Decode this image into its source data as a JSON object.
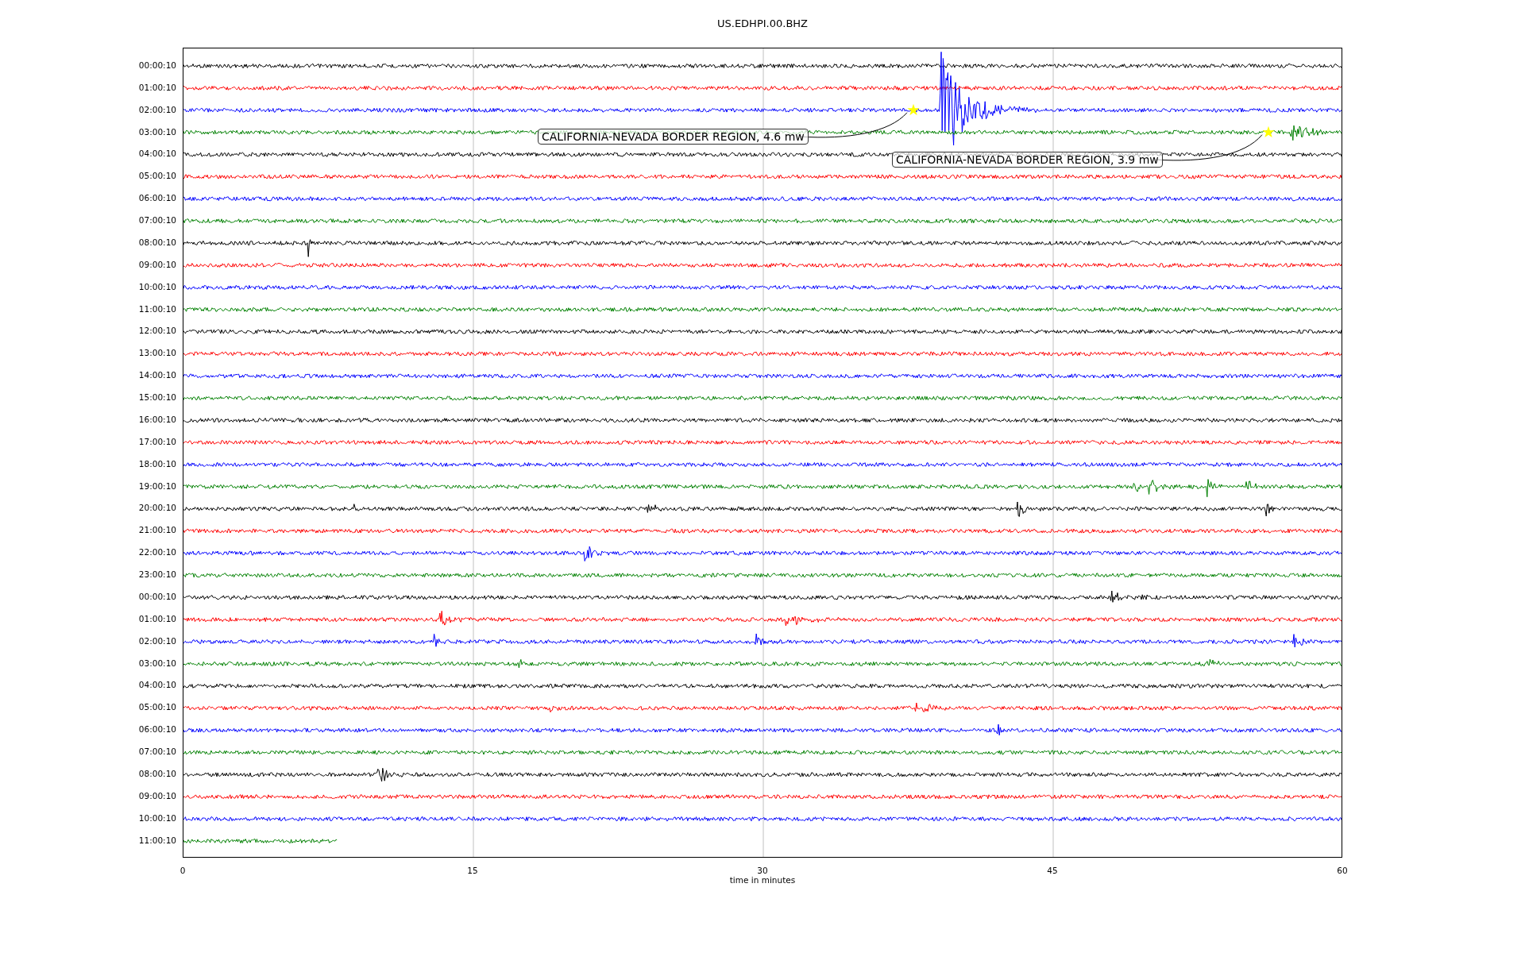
{
  "figure": {
    "title": "US.EDHPI.00.BHZ",
    "rows": [
      {
        "label": "00:00:10",
        "color": "#000000",
        "level": 1
      },
      {
        "label": "01:00:10",
        "color": "#ff0000",
        "level": 1
      },
      {
        "label": "02:00:10",
        "color": "#0000ff",
        "level": 1
      },
      {
        "label": "03:00:10",
        "color": "#008000",
        "level": 1
      },
      {
        "label": "04:00:10",
        "color": "#000000",
        "level": 1
      },
      {
        "label": "05:00:10",
        "color": "#ff0000",
        "level": 1
      },
      {
        "label": "06:00:10",
        "color": "#0000ff",
        "level": 1
      },
      {
        "label": "07:00:10",
        "color": "#008000",
        "level": 1
      },
      {
        "label": "08:00:10",
        "color": "#000000",
        "level": 1
      },
      {
        "label": "09:00:10",
        "color": "#ff0000",
        "level": 1
      },
      {
        "label": "10:00:10",
        "color": "#0000ff",
        "level": 1
      },
      {
        "label": "11:00:10",
        "color": "#008000",
        "level": 1
      },
      {
        "label": "12:00:10",
        "color": "#000000",
        "level": 1
      },
      {
        "label": "13:00:10",
        "color": "#ff0000",
        "level": 1
      },
      {
        "label": "14:00:10",
        "color": "#0000ff",
        "level": 1
      },
      {
        "label": "15:00:10",
        "color": "#008000",
        "level": 1
      },
      {
        "label": "16:00:10",
        "color": "#000000",
        "level": 1
      },
      {
        "label": "17:00:10",
        "color": "#ff0000",
        "level": 1
      },
      {
        "label": "18:00:10",
        "color": "#0000ff",
        "level": 1
      },
      {
        "label": "19:00:10",
        "color": "#008000",
        "level": 1
      },
      {
        "label": "20:00:10",
        "color": "#000000",
        "level": 1
      },
      {
        "label": "21:00:10",
        "color": "#ff0000",
        "level": 1
      },
      {
        "label": "22:00:10",
        "color": "#0000ff",
        "level": 1
      },
      {
        "label": "23:00:10",
        "color": "#008000",
        "level": 1
      },
      {
        "label": "00:00:10",
        "color": "#000000",
        "level": 1
      },
      {
        "label": "01:00:10",
        "color": "#ff0000",
        "level": 1
      },
      {
        "label": "02:00:10",
        "color": "#0000ff",
        "level": 1
      },
      {
        "label": "03:00:10",
        "color": "#008000",
        "level": 1
      },
      {
        "label": "04:00:10",
        "color": "#000000",
        "level": 1
      },
      {
        "label": "05:00:10",
        "color": "#ff0000",
        "level": 1
      },
      {
        "label": "06:00:10",
        "color": "#0000ff",
        "level": 1
      },
      {
        "label": "07:00:10",
        "color": "#008000",
        "level": 1
      },
      {
        "label": "08:00:10",
        "color": "#000000",
        "level": 1
      },
      {
        "label": "09:00:10",
        "color": "#ff0000",
        "level": 1
      },
      {
        "label": "10:00:10",
        "color": "#0000ff",
        "level": 1
      },
      {
        "label": "11:00:10",
        "color": "#008000",
        "level": 0.133
      }
    ],
    "events": [
      {
        "label": "CALIFORNIA-NEVADA BORDER REGION, 4.6 mw"
      },
      {
        "label": "CALIFORNIA-NEVADA BORDER REGION, 3.9 mw"
      }
    ],
    "xaxis": {
      "ticks": [
        "0",
        "15",
        "30",
        "45",
        "60"
      ],
      "label": "time in minutes"
    }
  }
}
